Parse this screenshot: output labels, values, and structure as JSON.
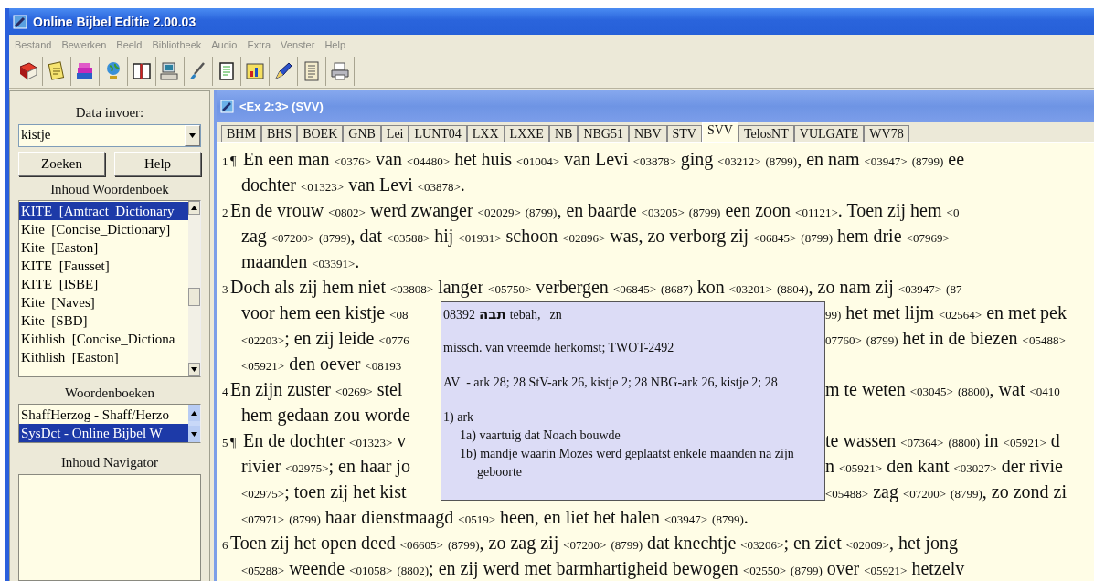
{
  "window": {
    "title": "Online Bijbel Editie 2.00.03"
  },
  "menu": [
    "Bestand",
    "Bewerken",
    "Beeld",
    "Bibliotheek",
    "Audio",
    "Extra",
    "Venster",
    "Help"
  ],
  "search": {
    "label": "Data invoer:",
    "value": "kistje",
    "buttons": [
      "Zoeken",
      "Help"
    ]
  },
  "dictionary_contents": {
    "label": "Inhoud Woordenboek",
    "items": [
      {
        "label": "KITE  [Amtract_Dictionary",
        "selected": true
      },
      {
        "label": "Kite  [Concise_Dictionary]",
        "selected": false
      },
      {
        "label": "Kite  [Easton]",
        "selected": false
      },
      {
        "label": "KITE  [Fausset]",
        "selected": false
      },
      {
        "label": "KITE  [ISBE]",
        "selected": false
      },
      {
        "label": "Kite  [Naves]",
        "selected": false
      },
      {
        "label": "Kite  [SBD]",
        "selected": false
      },
      {
        "label": "Kithlish  [Concise_Dictiona",
        "selected": false
      },
      {
        "label": "Kithlish  [Easton]",
        "selected": false
      }
    ]
  },
  "dictionaries": {
    "label": "Woordenboeken",
    "items": [
      {
        "label": "ShaffHerzog - Shaff/Herzo",
        "selected": false
      },
      {
        "label": "SysDct - Online Bijbel W",
        "selected": true
      }
    ]
  },
  "navigator": {
    "label": "Inhoud Navigator"
  },
  "document": {
    "title": "<Ex 2:3> (SVV)",
    "tabs": [
      {
        "label": "BHM",
        "selected": false
      },
      {
        "label": "BHS",
        "selected": false
      },
      {
        "label": "BOEK",
        "selected": false
      },
      {
        "label": "GNB",
        "selected": false
      },
      {
        "label": "Lei",
        "selected": false
      },
      {
        "label": "LUNT04",
        "selected": false
      },
      {
        "label": "LXX",
        "selected": false
      },
      {
        "label": "LXXE",
        "selected": false
      },
      {
        "label": "NB",
        "selected": false
      },
      {
        "label": "NBG51",
        "selected": false
      },
      {
        "label": "NBV",
        "selected": false
      },
      {
        "label": "STV",
        "selected": false
      },
      {
        "label": "SVV",
        "selected": true
      },
      {
        "label": "TelosNT",
        "selected": false
      },
      {
        "label": "VULGATE",
        "selected": false
      },
      {
        "label": "WV78",
        "selected": false
      }
    ],
    "verses": [
      {
        "number": "1",
        "mark": "¶",
        "lines": [
          {
            "text": "En een man <0376> van <04480> het huis <01004> van Levi <03878> ging <03212> (8799), en nam <03947> (8799) ee"
          },
          {
            "text": "dochter <01323> van Levi <03878>."
          }
        ]
      },
      {
        "number": "2",
        "lines": [
          {
            "text": "En de vrouw <0802> werd zwanger <02029> (8799), en baarde <03205> (8799) een zoon <01121>. Toen zij hem <0"
          },
          {
            "text": "zag <07200> (8799), dat <03588> hij <01931> schoon <02896> was, zo verborg zij <06845> (8799) hem drie <07969>"
          },
          {
            "text": "maanden <03391>."
          }
        ]
      },
      {
        "number": "3",
        "lines": [
          {
            "text": "Doch als zij hem niet <03808> langer <05750> verbergen <06845> (8687) kon <03201> (8804), zo nam zij <03947> (87"
          },
          {
            "left": "voor hem een kistje <08",
            "right": "99) het met lijm <02564> en met pek"
          },
          {
            "left": "<02203>; en zij leide <0776",
            "right": "07760> (8799) het in de biezen <05488>"
          },
          {
            "left": "<05921> den oever <08193"
          }
        ]
      },
      {
        "number": "4",
        "lines": [
          {
            "left": "En zijn zuster <0269> stel",
            "right": "m te weten <03045> (8800), wat <0410"
          },
          {
            "left": "hem gedaan zou worde"
          }
        ]
      },
      {
        "number": "5",
        "mark": "¶",
        "lines": [
          {
            "left": "En de dochter <01323> v",
            "right": "te wassen <07364> (8800) in <05921> d"
          },
          {
            "left": "rivier <02975>; en haar jo",
            "right": "n <05921> den kant <03027> der rivie"
          },
          {
            "left": "<02975>; toen zij het kist",
            "right": "<05488> zag <07200> (8799), zo zond zi"
          },
          {
            "text": "<07971> (8799) haar dienstmaagd <0519> heen, en liet het halen <03947> (8799)."
          }
        ]
      },
      {
        "number": "6",
        "lines": [
          {
            "text": "Toen zij het open deed <06605> (8799), zo zag zij <07200> (8799) dat knechtje <03206>; en ziet <02009>, het jong"
          },
          {
            "text": "<05288> weende <01058> (8802); en zij werd met barmhartigheid bewogen <02550> (8799) over <05921> hetzelv"
          }
        ]
      }
    ]
  },
  "popup": {
    "number": "08392",
    "hebrew": "תבה",
    "transliteration": "tebah,",
    "part_of_speech": "zn",
    "lines": [
      "missch. van vreemde herkomst; TWOT-2492",
      "AV  - ark 28; 28 StV-ark 26, kistje 2; 28 NBG-ark 26, kistje 2; 28"
    ],
    "senses": [
      {
        "label": "1) ark",
        "children": [
          {
            "label": "1a) vaartuig dat Noach bouwde"
          },
          {
            "label": "1b) mandje waarin Mozes werd geplaatst enkele maanden na zijn geboorte"
          }
        ]
      }
    ]
  }
}
